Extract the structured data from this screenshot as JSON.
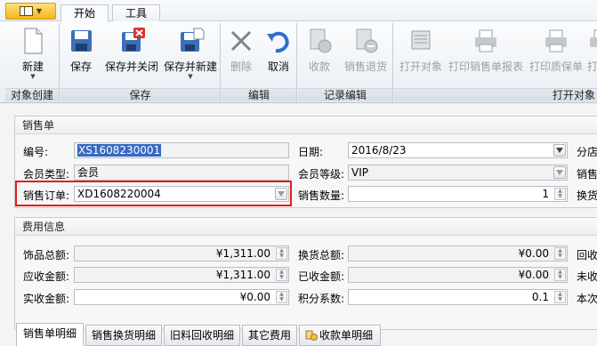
{
  "colors": {
    "accent_red": "#e31b1b",
    "selection": "#3569c4",
    "menu_orange": "#f2b51e"
  },
  "tabs": [
    {
      "label": "开始"
    },
    {
      "label": "工具"
    }
  ],
  "ribbon": {
    "groups": [
      {
        "label": "对象创建"
      },
      {
        "label": "保存"
      },
      {
        "label": "编辑"
      },
      {
        "label": "记录编辑"
      },
      {
        "label": "打开对象"
      }
    ],
    "buttons": {
      "new": "新建",
      "save": "保存",
      "save_close": "保存并关闭",
      "save_new": "保存并新建",
      "delete": "删除",
      "cancel": "取消",
      "collect": "收款",
      "sales_return": "销售退货",
      "open_object": "打开对象",
      "print_sales": "打印销售单报表",
      "print_warranty": "打印质保单",
      "print_more": "打"
    }
  },
  "sales": {
    "title": "销售单",
    "number_label": "编号:",
    "number_value": "XS1608230001",
    "date_label": "日期:",
    "date_value": "2016/8/23",
    "store_label": "分店",
    "member_type_label": "会员类型:",
    "member_type_value": "会员",
    "member_level_label": "会员等级:",
    "member_level_value": "VIP",
    "seller_label": "销售",
    "order_label": "销售订单:",
    "order_value": "XD1608220004",
    "qty_label": "销售数量:",
    "qty_value": "1",
    "exchange_label": "换货"
  },
  "fees": {
    "title": "费用信息",
    "jewelry_total_label": "饰品总额:",
    "jewelry_total_value": "¥1,311.00",
    "exchange_total_label": "换货总额:",
    "exchange_total_value": "¥0.00",
    "recycle_label": "回收",
    "receivable_label": "应收金额:",
    "receivable_value": "¥1,311.00",
    "received_label": "已收金额:",
    "received_value": "¥0.00",
    "unreceived_label": "未收",
    "actual_label": "实收金额:",
    "actual_value": "¥0.00",
    "points_label": "积分系数:",
    "points_value": "0.1",
    "this_label": "本次"
  },
  "bottom_tabs": [
    {
      "label": "销售单明细"
    },
    {
      "label": "销售换货明细"
    },
    {
      "label": "旧料回收明细"
    },
    {
      "label": "其它费用"
    },
    {
      "label": "收款单明细"
    }
  ]
}
